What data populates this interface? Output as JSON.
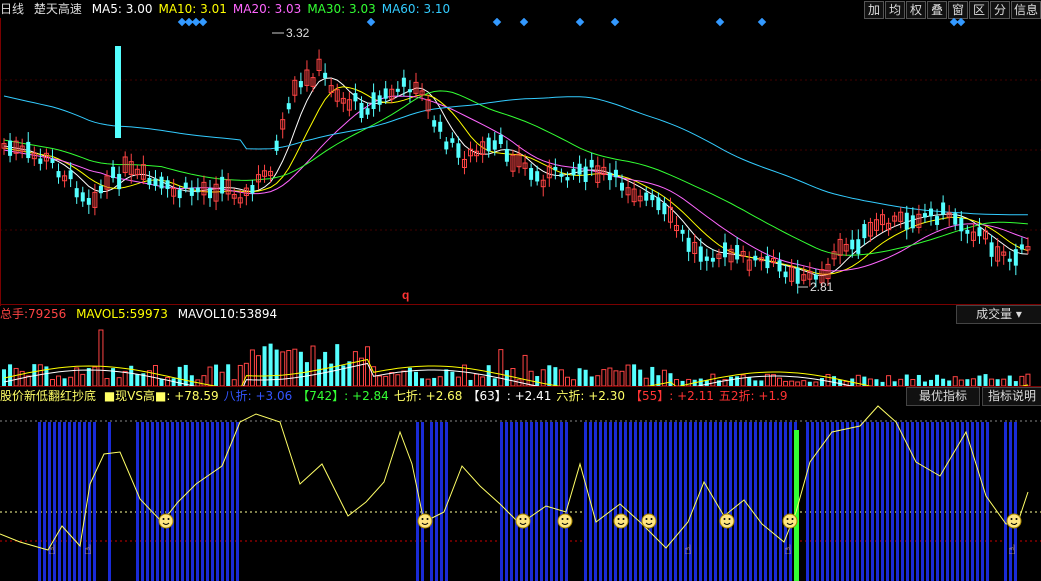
{
  "header": {
    "period": "日线",
    "stock": "楚天高速",
    "ma": [
      {
        "label": "MA5:",
        "value": "3.00",
        "color": "#ffffff"
      },
      {
        "label": "MA10:",
        "value": "3.01",
        "color": "#ffff00"
      },
      {
        "label": "MA20:",
        "value": "3.03",
        "color": "#ff66ff"
      },
      {
        "label": "MA30:",
        "value": "3.03",
        "color": "#33ff33"
      },
      {
        "label": "MA60:",
        "value": "3.10",
        "color": "#33ccff"
      }
    ]
  },
  "toolbar": {
    "items": [
      "加",
      "均",
      "权",
      "叠",
      "窗",
      "区",
      "分",
      "信息"
    ]
  },
  "price_panel": {
    "high_label": "3.32",
    "low_label": "2.81",
    "marker": "q"
  },
  "volume_panel": {
    "total_label": "总手:",
    "total_value": "79256",
    "mavol5_label": "MAVOL5:",
    "mavol5_value": "59973",
    "mavol10_label": "MAVOL10:",
    "mavol10_value": "53894",
    "selector": "成交量"
  },
  "indicator_panel": {
    "name": "股价新低翻红抄底",
    "items": [
      {
        "text": "■现VS高■: +78.59",
        "color": "#ffff66"
      },
      {
        "text": "八折: +3.06",
        "color": "#3355ff"
      },
      {
        "text": "【742】: +2.84",
        "color": "#33ff33"
      },
      {
        "text": "七折: +2.68",
        "color": "#ffff66"
      },
      {
        "text": "【63】: +2.41",
        "color": "#ffffff"
      },
      {
        "text": "六折: +2.30",
        "color": "#ffff66"
      },
      {
        "text": "【55】: +2.11",
        "color": "#ff3333"
      },
      {
        "text": "五2折: +1.9",
        "color": "#ff3333"
      }
    ],
    "btn_best": "最优指标",
    "btn_help": "指标说明"
  }
}
